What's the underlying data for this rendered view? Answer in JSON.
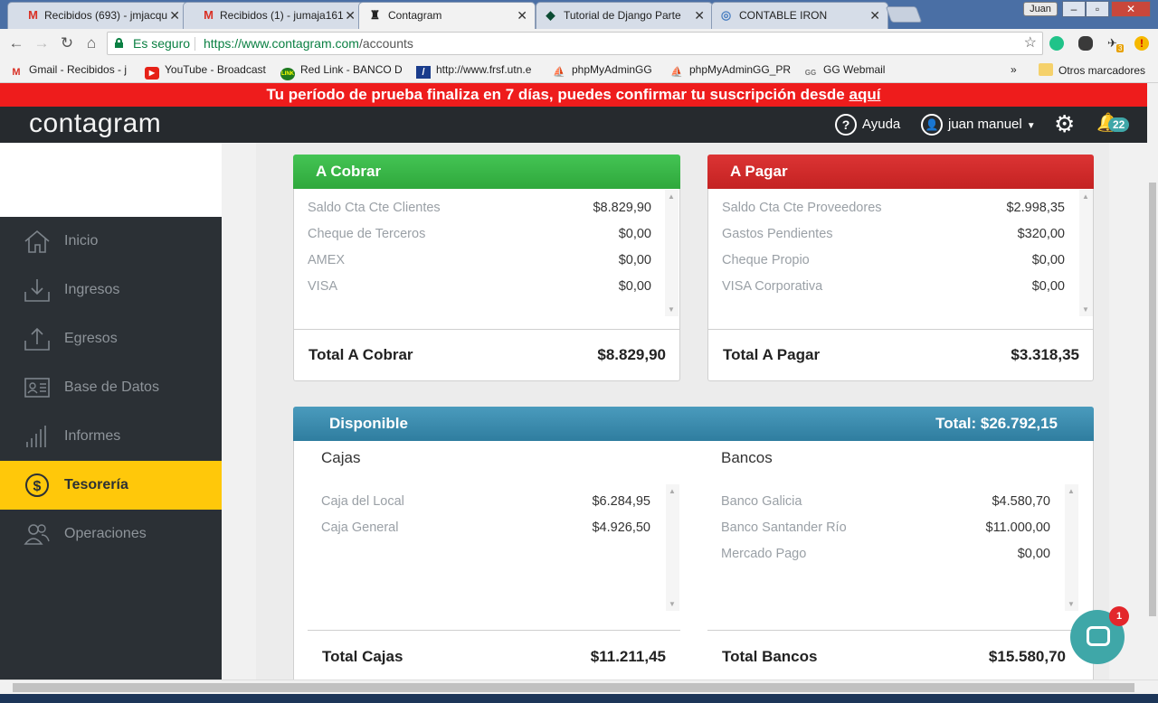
{
  "browser": {
    "tabs": [
      {
        "title": "Recibidos (693) - jmjacqu",
        "icon": "gmail-icon"
      },
      {
        "title": "Recibidos (1) - jumaja161",
        "icon": "gmail-icon"
      },
      {
        "title": "Contagram",
        "icon": "contagram-icon"
      },
      {
        "title": "Tutorial de Django Parte",
        "icon": "django-icon"
      },
      {
        "title": "CONTABLE IRON",
        "icon": "globe-icon"
      }
    ],
    "window_user": "Juan",
    "secure_label": "Es seguro",
    "url_host": "https://www.contagram.com",
    "url_path": "/accounts",
    "bookmarks": [
      "Gmail - Recibidos - j",
      "YouTube - Broadcast",
      "Red Link - BANCO D",
      "http://www.frsf.utn.e",
      "phpMyAdminGG",
      "phpMyAdminGG_PR",
      "GG Webmail"
    ],
    "bookmarks_overflow": "»",
    "other_bookmarks": "Otros marcadores",
    "extension_badge": "3"
  },
  "banner": {
    "text": "Tu período de prueba finaliza en 7 días, puedes confirmar tu suscripción desde ",
    "link": "aquí"
  },
  "header": {
    "logo": "contagram",
    "help_label": "Ayuda",
    "user_name": "juan manuel",
    "notifications": "22"
  },
  "sidebar": {
    "items": [
      {
        "label": "Inicio",
        "icon": "home-icon"
      },
      {
        "label": "Ingresos",
        "icon": "download-tray-icon"
      },
      {
        "label": "Egresos",
        "icon": "upload-tray-icon"
      },
      {
        "label": "Base de Datos",
        "icon": "id-card-icon"
      },
      {
        "label": "Informes",
        "icon": "bar-chart-icon"
      },
      {
        "label": "Tesorería",
        "icon": "dollar-circle-icon"
      },
      {
        "label": "Operaciones",
        "icon": "users-icon"
      }
    ]
  },
  "cobrar": {
    "title": "A Cobrar",
    "color": "#3cb54a",
    "rows": [
      {
        "label": "Saldo Cta Cte Clientes",
        "amount": "$8.829,90"
      },
      {
        "label": "Cheque de Terceros",
        "amount": "$0,00"
      },
      {
        "label": "AMEX",
        "amount": "$0,00"
      },
      {
        "label": "VISA",
        "amount": "$0,00"
      }
    ],
    "total_label": "Total A Cobrar",
    "total_amount": "$8.829,90"
  },
  "pagar": {
    "title": "A Pagar",
    "color": "#d42a2a",
    "rows": [
      {
        "label": "Saldo Cta Cte Proveedores",
        "amount": "$2.998,35"
      },
      {
        "label": "Gastos Pendientes",
        "amount": "$320,00"
      },
      {
        "label": "Cheque Propio",
        "amount": "$0,00"
      },
      {
        "label": "VISA Corporativa",
        "amount": "$0,00"
      }
    ],
    "total_label": "Total A Pagar",
    "total_amount": "$3.318,35"
  },
  "disponible": {
    "title": "Disponible",
    "total": "Total: $26.792,15",
    "color": "#3d8eb0",
    "cajas": {
      "title": "Cajas",
      "rows": [
        {
          "label": "Caja del Local",
          "amount": "$6.284,95"
        },
        {
          "label": "Caja General",
          "amount": "$4.926,50"
        }
      ],
      "total_label": "Total Cajas",
      "total_amount": "$11.211,45"
    },
    "bancos": {
      "title": "Bancos",
      "rows": [
        {
          "label": "Banco Galicia",
          "amount": "$4.580,70"
        },
        {
          "label": "Banco Santander Río",
          "amount": "$11.000,00"
        },
        {
          "label": "Mercado Pago",
          "amount": "$0,00"
        }
      ],
      "total_label": "Total Bancos",
      "total_amount": "$15.580,70"
    }
  },
  "chat": {
    "badge": "1"
  }
}
